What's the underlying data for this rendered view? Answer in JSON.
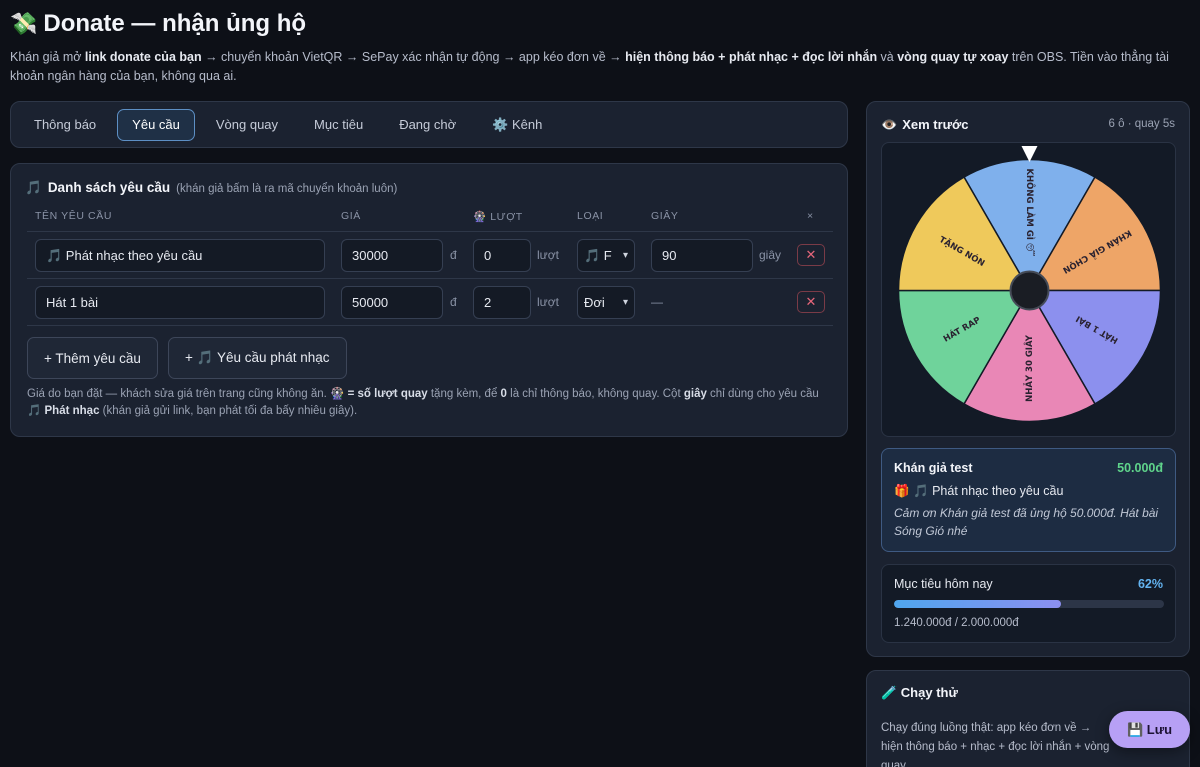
{
  "header": {
    "icon": "💸",
    "title": "Donate — nhận ủng hộ",
    "intro_parts": [
      "Khán giả mở ",
      "link donate của bạn",
      " → chuyển khoản VietQR → SePay xác nhận tự động → app kéo đơn về → ",
      "hiện thông báo + phát nhạc + đọc lời nhắn",
      " và ",
      "vòng quay tự xoay",
      " trên OBS. Tiền vào thẳng tài khoản ngân hàng của bạn, không qua ai."
    ]
  },
  "tabs": [
    {
      "label": "Thông báo",
      "active": false
    },
    {
      "label": "Yêu cầu",
      "active": true
    },
    {
      "label": "Vòng quay",
      "active": false
    },
    {
      "label": "Mục tiêu",
      "active": false
    },
    {
      "label": "Đang chờ",
      "active": false
    },
    {
      "label": "⚙️ Kênh",
      "active": false
    }
  ],
  "requests": {
    "icon": "🎵",
    "title": "Danh sách yêu cầu",
    "subtitle": "(khán giả bấm là ra mã chuyển khoản luôn)",
    "columns": [
      "TÊN YÊU CẦU",
      "GIÁ",
      "🎡 LƯỢT",
      "LOẠI",
      "GIÂY",
      "×"
    ],
    "currency_unit": "đ",
    "spin_unit": "lượt",
    "seconds_unit": "giây",
    "rows": [
      {
        "name": "🎵 Phát nhạc theo yêu cầu",
        "price": "30000",
        "spins": "0",
        "type": "🎵 F",
        "seconds": "90"
      },
      {
        "name": "Hát 1 bài",
        "price": "50000",
        "spins": "2",
        "type": "Đơi",
        "seconds": "—"
      }
    ],
    "delete_label": "✕",
    "add_button": "+ Thêm yêu cầu",
    "add_music_button": "+ 🎵 Yêu cầu phát nhạc",
    "note_parts": [
      "Giá do bạn đặt — khách sửa giá trên trang cũng không ăn. 🎡 ",
      "= số lượt quay",
      " tặng kèm, để ",
      "0",
      " là chỉ thông báo, không quay. Cột ",
      "giây",
      " chỉ dùng cho yêu cầu 🎵 ",
      "Phát nhạc",
      " (khán giả gửi link, bạn phát tối đa bấy nhiêu giây)."
    ]
  },
  "preview": {
    "icon": "👁️",
    "title": "Xem trước",
    "meta": "6 ô · quay 5s",
    "wheel_segments": [
      {
        "label": "KHÔNG LÀM GÌ 😴",
        "color": "#7fb0ec"
      },
      {
        "label": "KHÁN GIẢ CHỌN",
        "color": "#eea567"
      },
      {
        "label": "HÁT 1 BÀI",
        "color": "#8c90ee"
      },
      {
        "label": "NHẢY 30 GIÂY",
        "color": "#e987b6"
      },
      {
        "label": "HÁT RAP",
        "color": "#6fd39b"
      },
      {
        "label": "TẶNG NÓN",
        "color": "#efc95b"
      }
    ],
    "alert": {
      "name": "Khán giả test",
      "amount": "50.000đ",
      "item": "🎁 🎵 Phát nhạc theo yêu cầu",
      "message": "Cảm ơn Khán giả test đã ủng hộ 50.000đ. Hát bài Sóng Gió nhé"
    },
    "goal": {
      "label": "Mục tiêu hôm nay",
      "percent_text": "62%",
      "progress": 0.62,
      "summary": "1.240.000đ / 2.000.000đ"
    }
  },
  "trial": {
    "title": "🧪 Chạy thử",
    "body": "Chạy đúng luồng thật: app kéo đơn về → hiện thông báo + nhạc + đọc lời nhắn + vòng quay."
  },
  "save_button": "💾 Lưu"
}
